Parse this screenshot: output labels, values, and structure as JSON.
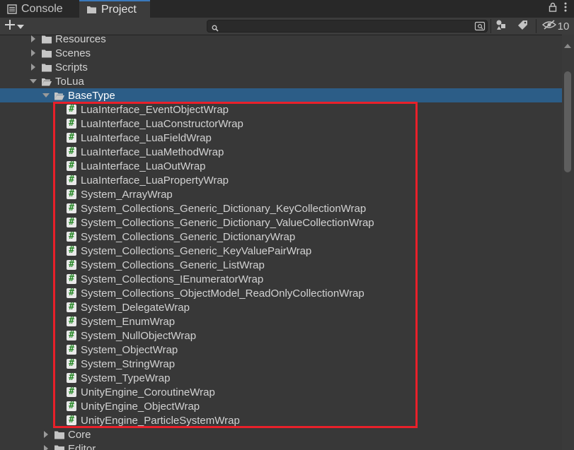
{
  "tabs": [
    {
      "label": "Console",
      "icon": "console-icon"
    },
    {
      "label": "Project",
      "icon": "folder-icon",
      "active": true
    }
  ],
  "toolbar": {
    "search_value": "",
    "hidden_count": "10"
  },
  "tree": {
    "folders_top": [
      {
        "label": "Resources",
        "level": 1,
        "expanded": false
      },
      {
        "label": "Scenes",
        "level": 1,
        "expanded": false
      },
      {
        "label": "Scripts",
        "level": 1,
        "expanded": false
      },
      {
        "label": "ToLua",
        "level": 1,
        "expanded": true
      },
      {
        "label": "BaseType",
        "level": 2,
        "expanded": true,
        "selected": true
      }
    ],
    "files": [
      "LuaInterface_EventObjectWrap",
      "LuaInterface_LuaConstructorWrap",
      "LuaInterface_LuaFieldWrap",
      "LuaInterface_LuaMethodWrap",
      "LuaInterface_LuaOutWrap",
      "LuaInterface_LuaPropertyWrap",
      "System_ArrayWrap",
      "System_Collections_Generic_Dictionary_KeyCollectionWrap",
      "System_Collections_Generic_Dictionary_ValueCollectionWrap",
      "System_Collections_Generic_DictionaryWrap",
      "System_Collections_Generic_KeyValuePairWrap",
      "System_Collections_Generic_ListWrap",
      "System_Collections_IEnumeratorWrap",
      "System_Collections_ObjectModel_ReadOnlyCollectionWrap",
      "System_DelegateWrap",
      "System_EnumWrap",
      "System_NullObjectWrap",
      "System_ObjectWrap",
      "System_StringWrap",
      "System_TypeWrap",
      "UnityEngine_CoroutineWrap",
      "UnityEngine_ObjectWrap",
      "UnityEngine_ParticleSystemWrap"
    ],
    "file_icon": "csharp-script-icon",
    "folders_bottom": [
      {
        "label": "Core",
        "level": 2,
        "expanded": false
      },
      {
        "label": "Editor",
        "level": 2,
        "expanded": false
      }
    ]
  },
  "colors": {
    "background": "#383838",
    "selection": "#2c5d87",
    "highlight_box": "#e8202a",
    "script_hash": "#2a8a2a"
  }
}
